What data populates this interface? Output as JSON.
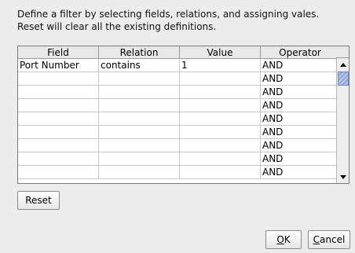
{
  "description": {
    "line1": "Define a filter by selecting fields, relations, and assigning vales.",
    "line2": "Reset will clear all the existing definitions."
  },
  "grid": {
    "columns": [
      "Field",
      "Relation",
      "Value",
      "Operator"
    ],
    "rows": [
      [
        "Port Number",
        "contains",
        "1",
        "AND"
      ],
      [
        "",
        "",
        "",
        "AND"
      ],
      [
        "",
        "",
        "",
        "AND"
      ],
      [
        "",
        "",
        "",
        "AND"
      ],
      [
        "",
        "",
        "",
        "AND"
      ],
      [
        "",
        "",
        "",
        "AND"
      ],
      [
        "",
        "",
        "",
        "AND"
      ],
      [
        "",
        "",
        "",
        "AND"
      ],
      [
        "",
        "",
        "",
        "AND"
      ]
    ]
  },
  "buttons": {
    "reset": "Reset",
    "ok_mnemonic": "O",
    "ok_rest": "K",
    "cancel_mnemonic": "C",
    "cancel_rest": "ancel"
  }
}
